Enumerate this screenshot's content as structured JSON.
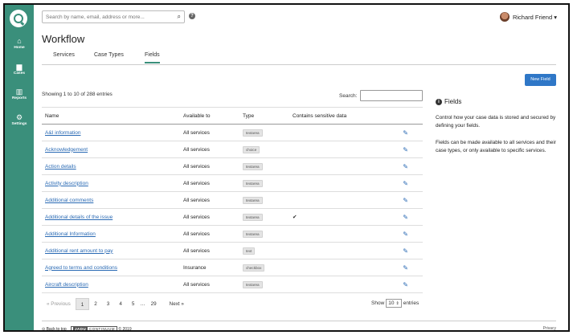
{
  "sidebar": {
    "items": [
      {
        "label": "Home",
        "icon": "home-icon",
        "glyph": "⌂"
      },
      {
        "label": "Cases",
        "icon": "cases-icon",
        "glyph": "▆"
      },
      {
        "label": "Reports",
        "icon": "reports-icon",
        "glyph": "▥"
      },
      {
        "label": "Settings",
        "icon": "gear-icon",
        "glyph": "⚙"
      }
    ]
  },
  "header": {
    "search_placeholder": "Search by name, email, address or more...",
    "help_glyph": "?",
    "user_name": "Richard Friend ▾"
  },
  "page": {
    "title": "Workflow",
    "tabs": [
      "Services",
      "Case Types",
      "Fields"
    ],
    "new_button": "New Field"
  },
  "table": {
    "showing": "Showing 1 to 10 of 288 entries",
    "search_label": "Search:",
    "columns": [
      "Name",
      "Available to",
      "Type",
      "Contains sensitive data"
    ],
    "rows": [
      {
        "name": "A&I information",
        "available": "All services",
        "type": "textarea",
        "sensitive": ""
      },
      {
        "name": "Acknowledgement",
        "available": "All services",
        "type": "choice",
        "sensitive": ""
      },
      {
        "name": "Action details",
        "available": "All services",
        "type": "textarea",
        "sensitive": ""
      },
      {
        "name": "Activity description",
        "available": "All services",
        "type": "textarea",
        "sensitive": ""
      },
      {
        "name": "Additional comments",
        "available": "All services",
        "type": "textarea",
        "sensitive": ""
      },
      {
        "name": "Additional details of the issue",
        "available": "All services",
        "type": "textarea",
        "sensitive": "✔"
      },
      {
        "name": "Additional Information",
        "available": "All services",
        "type": "textarea",
        "sensitive": ""
      },
      {
        "name": "Additional rent amount to pay",
        "available": "All services",
        "type": "text",
        "sensitive": ""
      },
      {
        "name": "Agreed to terms and conditions",
        "available": "Insurance",
        "type": "checkbox",
        "sensitive": ""
      },
      {
        "name": "Aircraft description",
        "available": "All services",
        "type": "textarea",
        "sensitive": ""
      }
    ],
    "edit_glyph": "✎"
  },
  "pagination": {
    "previous": "« Previous",
    "pages": [
      "1",
      "2",
      "3",
      "4",
      "5",
      "…",
      "29"
    ],
    "next": "Next »",
    "show_label": "Show",
    "page_size": "10",
    "entries_label": "entries"
  },
  "aside": {
    "title": "Fields",
    "info_glyph": "i",
    "p1": "Control how your case data is stored and secured by defining your fields.",
    "p2": "Fields can be made available to all services and their case types, or only available to specific services."
  },
  "footer": {
    "back_to_top": "⊙ Back to top",
    "brand_a": "JADU",
    "brand_b": "CONTINUUM",
    "year": "© 2019",
    "privacy": "Privacy"
  },
  "colors": {
    "sidebar": "#3a8f7b",
    "primary_button": "#2f77c7",
    "link": "#2a6ab4"
  }
}
